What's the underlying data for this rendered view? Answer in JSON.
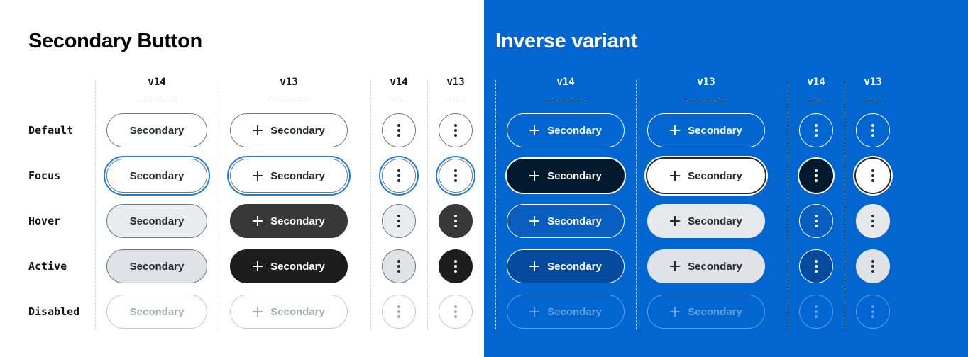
{
  "left_panel": {
    "title": "Secondary Button",
    "columns": [
      "v14",
      "v13",
      "v14",
      "v13"
    ]
  },
  "right_panel": {
    "title": "Inverse variant",
    "background": "#0266d0",
    "columns": [
      "v14",
      "v13",
      "v14",
      "v13"
    ]
  },
  "states": [
    "Default",
    "Focus",
    "Hover",
    "Active",
    "Disabled"
  ],
  "button_label": "Secondary",
  "icons": {
    "add": "plus-icon",
    "more": "more-vertical-icon"
  },
  "colors": {
    "focus_ring": "#1d7ce0",
    "inverse_bg": "#0266d0",
    "hover_dark": "#383838",
    "active_dark": "#1d1d1d"
  }
}
